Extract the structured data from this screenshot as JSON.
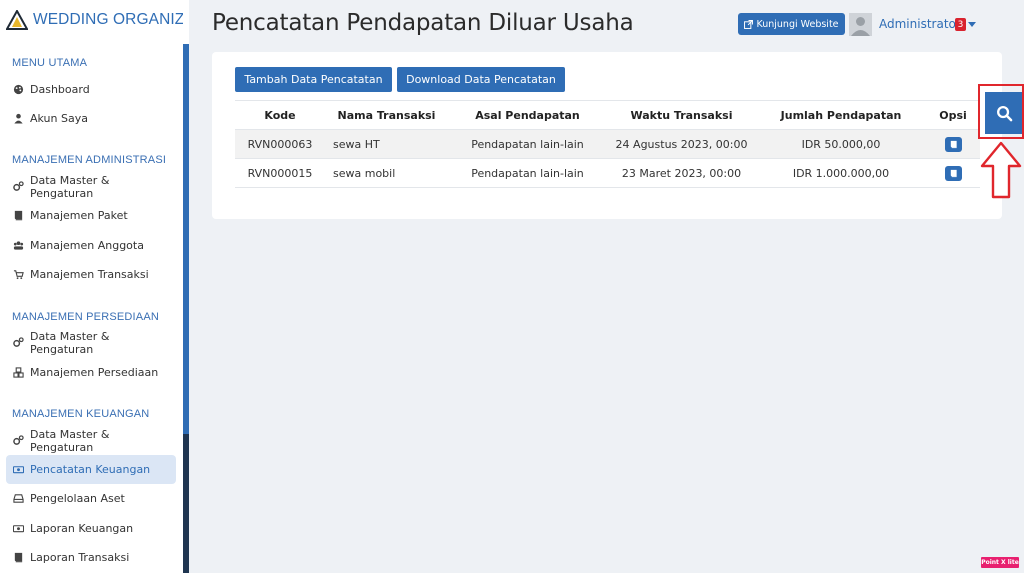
{
  "brand": {
    "name": "WEDDING ORGANIZER"
  },
  "sidebar": {
    "sections": [
      {
        "title": "MENU UTAMA",
        "items": [
          {
            "label": "Dashboard",
            "icon": "palette-icon"
          },
          {
            "label": "Akun Saya",
            "icon": "user-icon"
          }
        ]
      },
      {
        "title": "MANAJEMEN ADMINISTRASI",
        "items": [
          {
            "label": "Data Master & Pengaturan",
            "icon": "cogs-icon"
          },
          {
            "label": "Manajemen Paket",
            "icon": "book-icon"
          },
          {
            "label": "Manajemen Anggota",
            "icon": "users-icon"
          },
          {
            "label": "Manajemen Transaksi",
            "icon": "cart-icon"
          }
        ]
      },
      {
        "title": "MANAJEMEN PERSEDIAAN",
        "items": [
          {
            "label": "Data Master & Pengaturan",
            "icon": "cogs-icon"
          },
          {
            "label": "Manajemen Persediaan",
            "icon": "cubes-icon"
          }
        ]
      },
      {
        "title": "MANAJEMEN KEUANGAN",
        "items": [
          {
            "label": "Data Master & Pengaturan",
            "icon": "cogs-icon"
          },
          {
            "label": "Pencatatan Keuangan",
            "icon": "money-icon",
            "active": true
          },
          {
            "label": "Pengelolaan Aset",
            "icon": "hdd-icon"
          },
          {
            "label": "Laporan Keuangan",
            "icon": "money-icon"
          },
          {
            "label": "Laporan Transaksi",
            "icon": "book-icon"
          }
        ]
      }
    ]
  },
  "header": {
    "title": "Pencatatan Pendapatan Diluar Usaha",
    "visit_label": "Kunjungi Website",
    "user_name": "Administrator",
    "notification_count": "3"
  },
  "actions": {
    "add_label": "Tambah Data Pencatatan",
    "download_label": "Download Data Pencatatan"
  },
  "table": {
    "columns": [
      "Kode",
      "Nama Transaksi",
      "Asal Pendapatan",
      "Waktu Transaksi",
      "Jumlah Pendapatan",
      "Opsi"
    ],
    "rows": [
      {
        "kode": "RVN000063",
        "nama": "sewa HT",
        "asal": "Pendapatan lain-lain",
        "waktu": "24 Agustus 2023, 00:00",
        "jumlah": "IDR 50.000,00"
      },
      {
        "kode": "RVN000015",
        "nama": "sewa mobil",
        "asal": "Pendapatan lain-lain",
        "waktu": "23 Maret 2023, 00:00",
        "jumlah": "IDR 1.000.000,00"
      }
    ]
  },
  "colors": {
    "primary": "#2f6db5",
    "highlight": "#e0262c",
    "badge": "#d9232e"
  },
  "watermark": "Point X lite"
}
